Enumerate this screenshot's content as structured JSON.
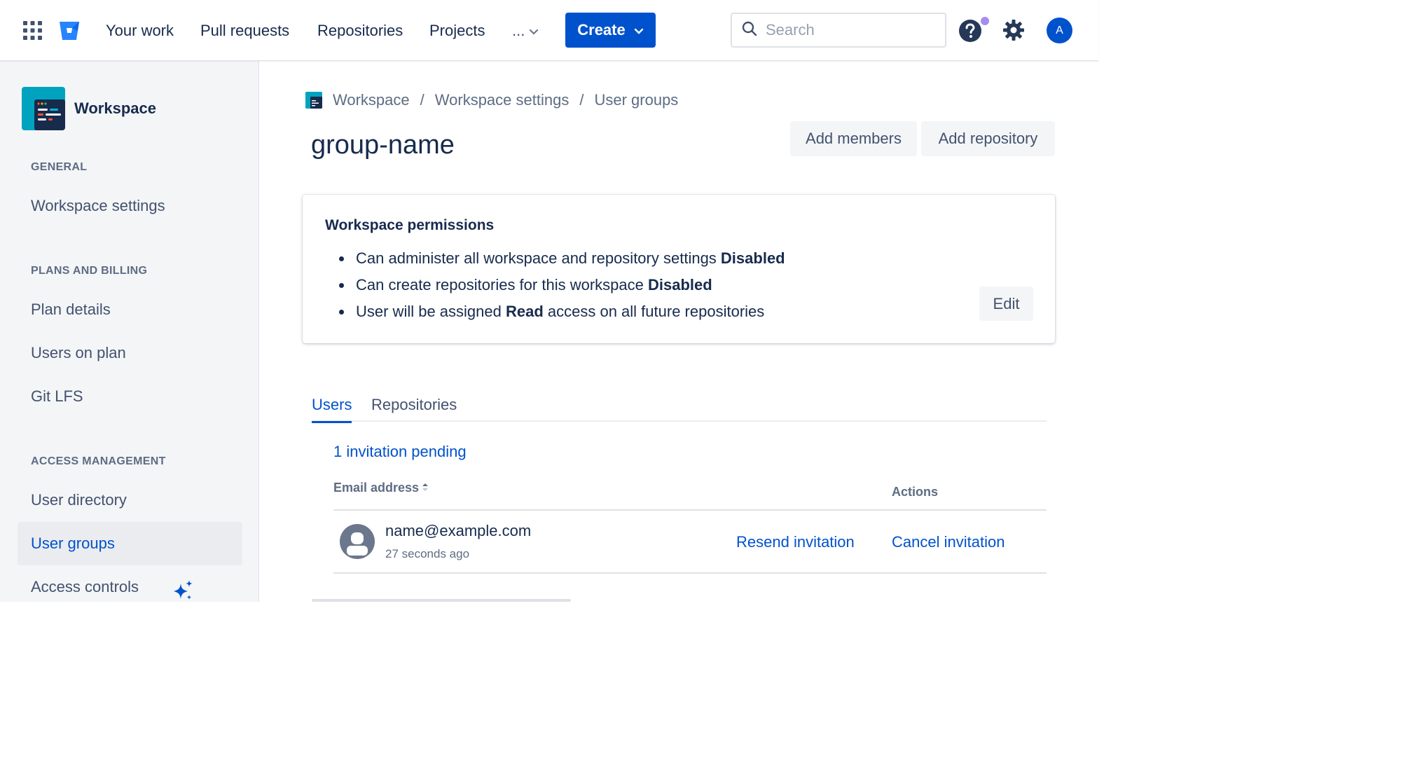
{
  "topnav": {
    "items": [
      "Your work",
      "Pull requests",
      "Repositories",
      "Projects"
    ],
    "more_label": "...",
    "create_label": "Create",
    "search_placeholder": "Search",
    "avatar_initial": "A"
  },
  "sidebar": {
    "workspace_name": "Workspace",
    "sections": [
      {
        "heading": "GENERAL",
        "items": [
          "Workspace settings"
        ]
      },
      {
        "heading": "PLANS AND BILLING",
        "items": [
          "Plan details",
          "Users on plan",
          "Git LFS"
        ]
      },
      {
        "heading": "ACCESS MANAGEMENT",
        "items": [
          "User directory",
          "User groups",
          "Access controls"
        ]
      }
    ],
    "active_item": "User groups"
  },
  "breadcrumb": {
    "items": [
      "Workspace",
      "Workspace settings",
      "User groups"
    ],
    "separator": "/"
  },
  "page": {
    "title": "group-name",
    "add_members_label": "Add members",
    "add_repository_label": "Add repository"
  },
  "permissions": {
    "title": "Workspace permissions",
    "items": [
      {
        "before": "Can administer all workspace and repository settings ",
        "bold": "Disabled",
        "after": ""
      },
      {
        "before": "Can create repositories for this workspace ",
        "bold": "Disabled",
        "after": ""
      },
      {
        "before": "User will be assigned ",
        "bold": "Read",
        "after": " access on all future repositories"
      }
    ],
    "edit_label": "Edit"
  },
  "tabs": {
    "users": "Users",
    "repositories": "Repositories",
    "active": "Users"
  },
  "invitations": {
    "pending_label": "1 invitation pending",
    "columns": {
      "email": "Email address",
      "actions": "Actions"
    },
    "rows": [
      {
        "email": "name@example.com",
        "time": "27 seconds ago",
        "resend_label": "Resend invitation",
        "cancel_label": "Cancel invitation"
      }
    ]
  },
  "colors": {
    "primary": "#0052cc",
    "text": "#172b4d",
    "subtle": "#5e6c84",
    "sidebar_bg": "#f4f5f7",
    "notification_dot": "#a58ef0"
  }
}
